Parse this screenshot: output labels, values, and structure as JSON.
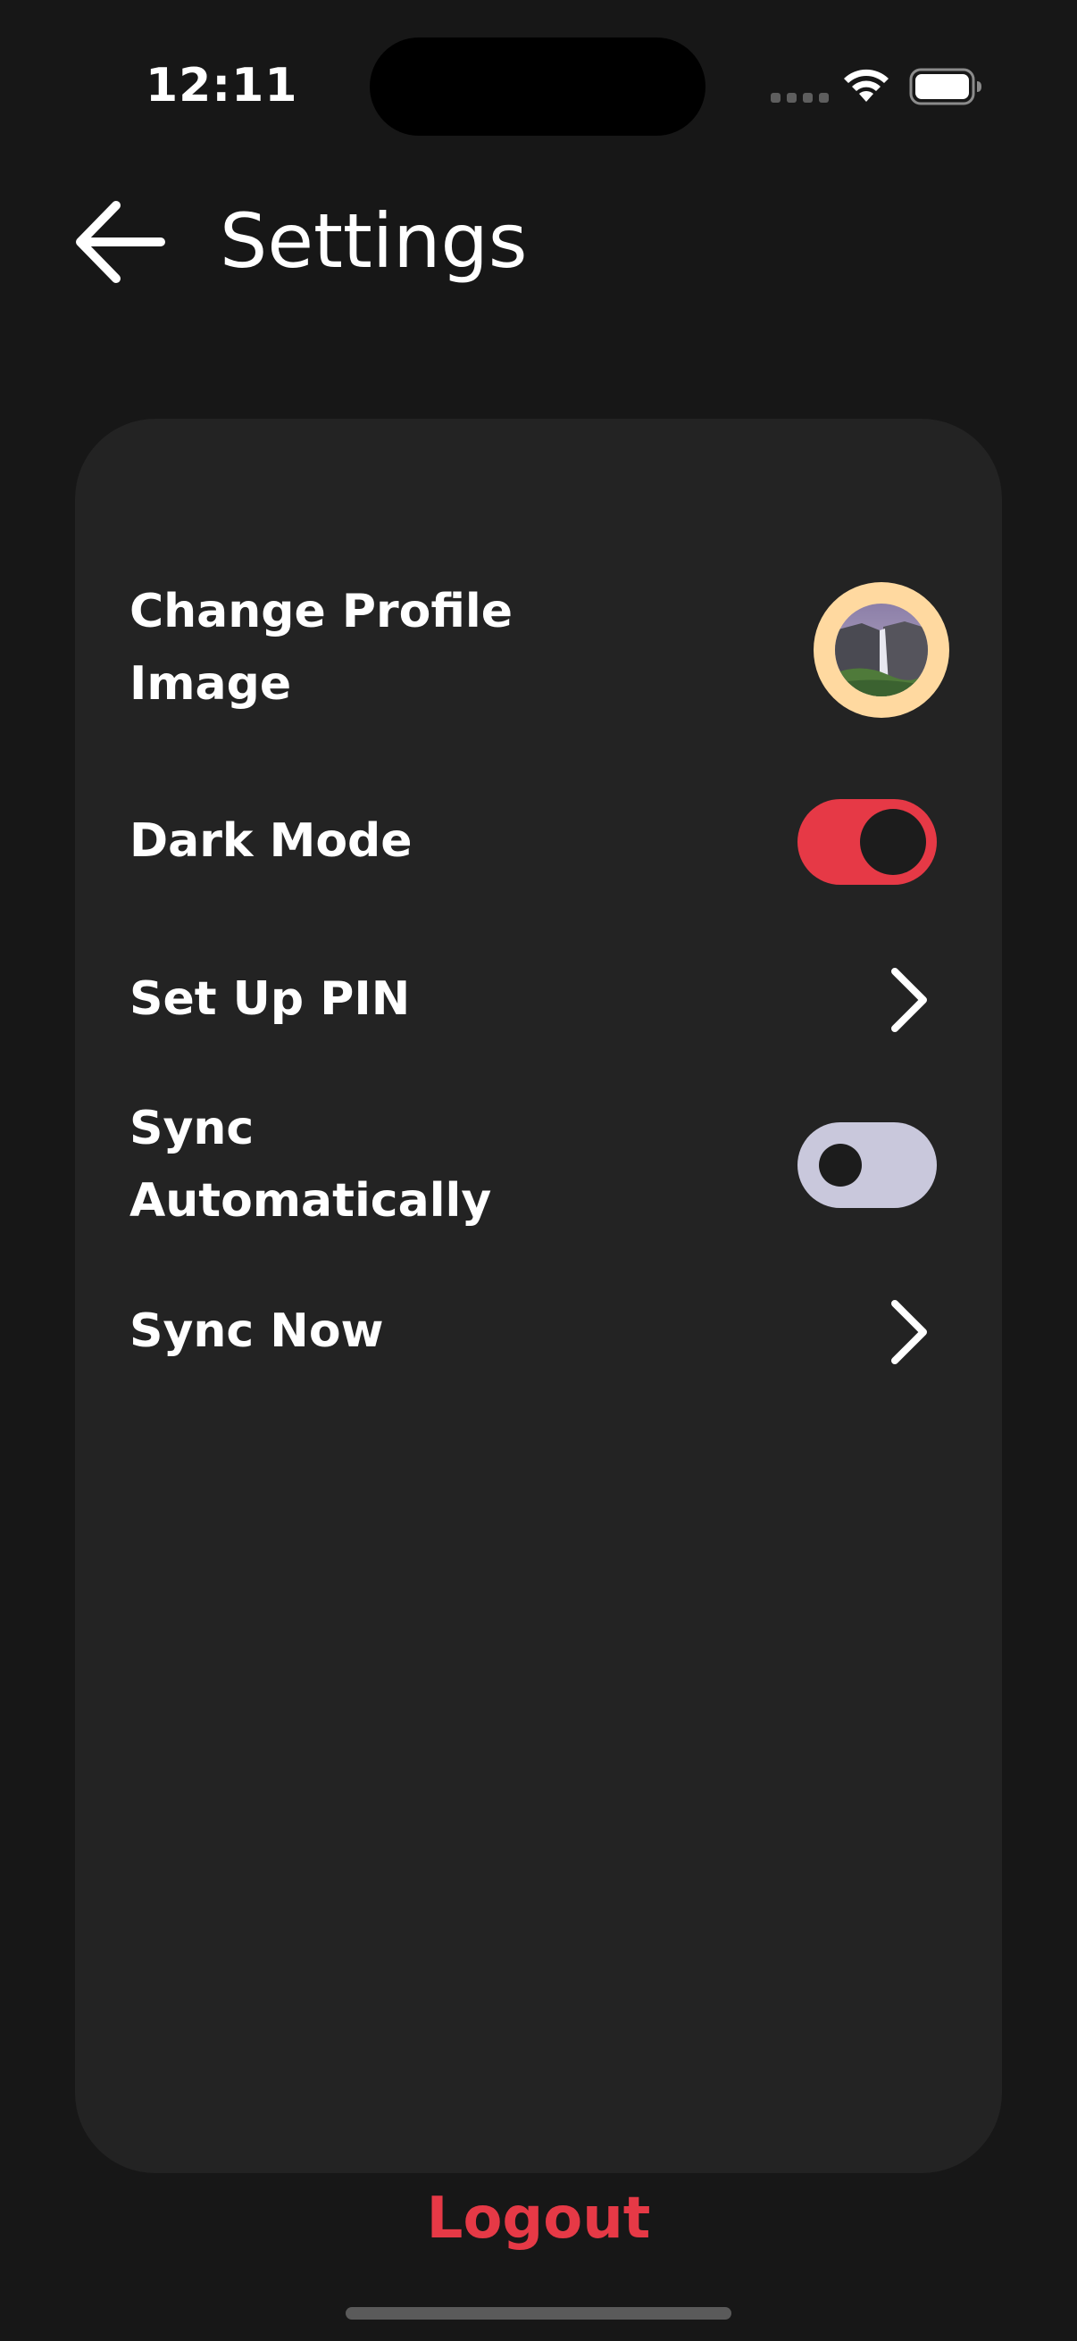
{
  "status_bar": {
    "time": "12:11"
  },
  "header": {
    "title": "Settings"
  },
  "settings": {
    "items": [
      {
        "label": "Change Profile Image",
        "control": "avatar"
      },
      {
        "label": "Dark Mode",
        "control": "toggle",
        "value": true
      },
      {
        "label": "Set Up PIN",
        "control": "chevron"
      },
      {
        "label": "Sync Automatically",
        "control": "toggle",
        "value": false
      },
      {
        "label": "Sync Now",
        "control": "chevron"
      }
    ]
  },
  "footer": {
    "logout_label": "Logout"
  },
  "colors": {
    "background": "#171717",
    "card": "#232323",
    "accent": "#e63946",
    "avatar_ring": "#ffd9a0",
    "toggle_off": "#c9c8dc"
  },
  "icons": {
    "back": "arrow-left-icon",
    "chevron": "chevron-right-icon",
    "wifi": "wifi-icon",
    "battery": "battery-icon"
  }
}
